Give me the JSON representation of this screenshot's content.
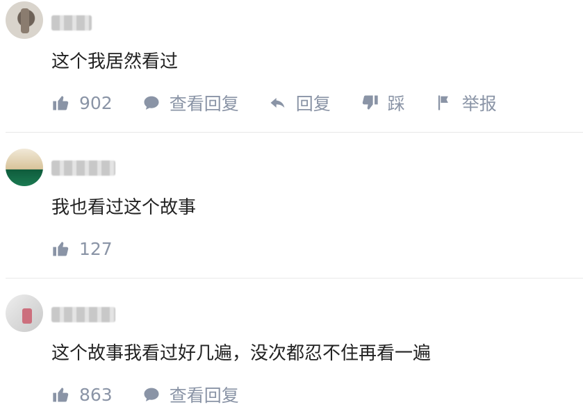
{
  "comments": [
    {
      "text": "这个我居然看过",
      "likes": "902",
      "actions": {
        "view_replies": "查看回复",
        "reply": "回复",
        "dislike": "踩",
        "report": "举报"
      }
    },
    {
      "text": "我也看过这个故事",
      "likes": "127"
    },
    {
      "text": "这个故事我看过好几遍，没次都忍不住再看一遍",
      "likes": "863",
      "actions": {
        "view_replies": "查看回复"
      }
    }
  ],
  "icons": {
    "like": "thumbs-up-icon",
    "comment": "comment-bubble-icon",
    "reply": "reply-arrow-icon",
    "dislike": "thumbs-down-icon",
    "report": "flag-icon"
  },
  "colors": {
    "action_text": "#8a94a6",
    "comment_text": "#222222",
    "divider": "#e8e8e8"
  }
}
